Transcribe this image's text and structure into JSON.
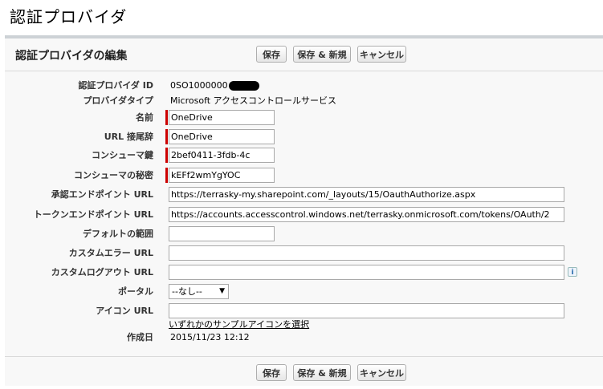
{
  "page": {
    "title": "認証プロバイダ"
  },
  "panel": {
    "title": "認証プロバイダの編集"
  },
  "buttons": {
    "save": "保存",
    "save_new": "保存 & 新規",
    "cancel": "キャンセル"
  },
  "fields": {
    "provider_id": {
      "label": "認証プロバイダ ID",
      "value": "0SO1000000"
    },
    "provider_type": {
      "label": "プロバイダタイプ",
      "value": "Microsoft アクセスコントロールサービス"
    },
    "name": {
      "label": "名前",
      "value": "OneDrive"
    },
    "url_suffix": {
      "label": "URL 接尾辞",
      "value": "OneDrive"
    },
    "consumer_key": {
      "label": "コンシューマ鍵",
      "value": "2bef0411-3fdb-4c"
    },
    "consumer_secret": {
      "label": "コンシューマの秘密",
      "value": "kEFf2wmYgYOC"
    },
    "authorize_url": {
      "label": "承認エンドポイント URL",
      "value": "https://terrasky-my.sharepoint.com/_layouts/15/OauthAuthorize.aspx"
    },
    "token_url": {
      "label": "トークンエンドポイント URL",
      "value": "https://accounts.accesscontrol.windows.net/terrasky.onmicrosoft.com/tokens/OAuth/2"
    },
    "default_scope": {
      "label": "デフォルトの範囲",
      "value": ""
    },
    "custom_error_url": {
      "label": "カスタムエラー URL",
      "value": ""
    },
    "custom_logout_url": {
      "label": "カスタムログアウト URL",
      "value": ""
    },
    "portal": {
      "label": "ポータル",
      "value": "--なし--"
    },
    "icon_url": {
      "label": "アイコン URL",
      "value": "",
      "link": "いずれかのサンプルアイコンを選択"
    },
    "created_date": {
      "label": "作成日",
      "value": "2015/11/23 12:12"
    }
  },
  "icons": {
    "info": "info-icon",
    "dropdown": "chevron-down-icon"
  },
  "colors": {
    "required": "#cc0000",
    "panel_border": "#cdd2d6"
  }
}
